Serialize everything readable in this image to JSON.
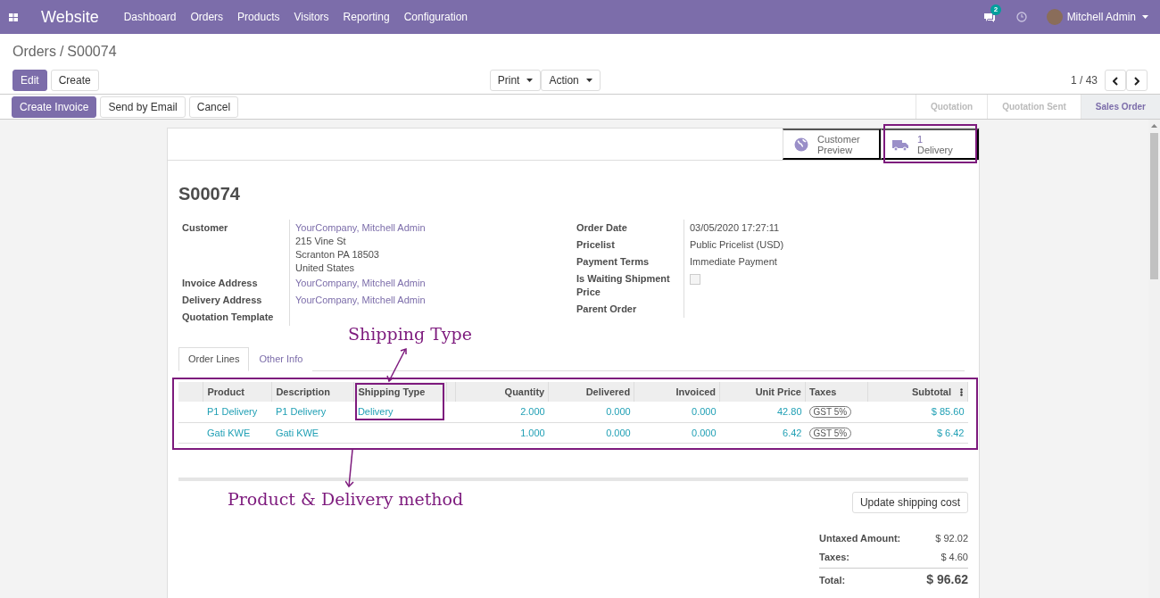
{
  "navbar": {
    "app": "Website",
    "menu": [
      "Dashboard",
      "Orders",
      "Products",
      "Visitors",
      "Reporting",
      "Configuration"
    ],
    "messages_count": "2",
    "user": "Mitchell Admin"
  },
  "breadcrumb": {
    "items": [
      "Orders",
      "S00074"
    ],
    "separator": "/"
  },
  "control_panel": {
    "buttons": [
      {
        "label": "Edit",
        "kind": "primary"
      },
      {
        "label": "Create",
        "kind": "secondary"
      }
    ],
    "dropdowns": [
      "Print",
      "Action"
    ],
    "pager": "1 / 43"
  },
  "status_bar": {
    "buttons": [
      {
        "label": "Create Invoice",
        "kind": "primary"
      },
      {
        "label": "Send by Email",
        "kind": "secondary"
      },
      {
        "label": "Cancel",
        "kind": "secondary"
      }
    ],
    "stages": [
      {
        "label": "Quotation",
        "selected": false
      },
      {
        "label": "Quotation Sent",
        "selected": false
      },
      {
        "label": "Sales Order",
        "selected": true
      }
    ]
  },
  "smart_buttons": [
    {
      "kind": "globe",
      "lines": [
        "Customer",
        "Preview"
      ]
    },
    {
      "kind": "truck",
      "lines": [
        "1",
        "Delivery"
      ]
    }
  ],
  "title": "S00074",
  "left_fields": [
    {
      "label": "Customer",
      "lines": [
        {
          "text": "YourCompany, Mitchell Admin",
          "link": true
        },
        {
          "text": "215 Vine St",
          "link": false
        },
        {
          "text": "Scranton PA 18503",
          "link": false
        },
        {
          "text": "United States",
          "link": false
        }
      ]
    },
    {
      "label": "Invoice Address",
      "lines": [
        {
          "text": "YourCompany, Mitchell Admin",
          "link": true
        }
      ]
    },
    {
      "label": "Delivery Address",
      "lines": [
        {
          "text": "YourCompany, Mitchell Admin",
          "link": true
        }
      ]
    },
    {
      "label": "Quotation Template"
    }
  ],
  "right_fields": [
    {
      "label": "Order Date",
      "kind": "text",
      "value": "03/05/2020 17:27:11"
    },
    {
      "label": "Pricelist",
      "kind": "text",
      "value": "Public Pricelist (USD)"
    },
    {
      "label": "Payment Terms",
      "kind": "text",
      "value": "Immediate Payment"
    },
    {
      "label": "Is Waiting Shipment Price",
      "kind": "checkbox",
      "checked": false
    },
    {
      "label": "Parent Order",
      "kind": "text"
    }
  ],
  "tabs": [
    {
      "label": "Order Lines",
      "selected": true
    },
    {
      "label": "Other Info",
      "selected": false
    }
  ],
  "table": {
    "columns": [
      {
        "label": "Product",
        "kind": "text"
      },
      {
        "label": "Description",
        "kind": "text"
      },
      {
        "label": "Shipping Type",
        "kind": "text"
      },
      {
        "label": "Quantity",
        "kind": "number"
      },
      {
        "label": "Delivered",
        "kind": "number"
      },
      {
        "label": "Invoiced",
        "kind": "number"
      },
      {
        "label": "Unit Price",
        "kind": "number"
      },
      {
        "label": "Taxes",
        "kind": "badge"
      },
      {
        "label": "Subtotal",
        "kind": "number"
      }
    ],
    "rows": [
      [
        "P1 Delivery",
        "P1 Delivery",
        "Delivery",
        "2.000",
        "0.000",
        "0.000",
        "42.80",
        "GST 5%",
        "$ 85.60"
      ],
      [
        "Gati KWE",
        "Gati KWE",
        "",
        "1.000",
        "0.000",
        "0.000",
        "6.42",
        "GST 5%",
        "$ 6.42"
      ]
    ]
  },
  "update_button": "Update shipping cost",
  "totals": [
    {
      "label": "Untaxed Amount:",
      "value": "$ 92.02",
      "kind": "sub"
    },
    {
      "label": "Taxes:",
      "value": "$ 4.60",
      "kind": "sub"
    },
    {
      "label": "Total:",
      "value": "$ 96.62",
      "kind": "grand"
    }
  ],
  "annotations": [
    {
      "kind": "shipping",
      "text": "Shipping Type"
    },
    {
      "kind": "product",
      "text": "Product & Delivery method"
    }
  ]
}
